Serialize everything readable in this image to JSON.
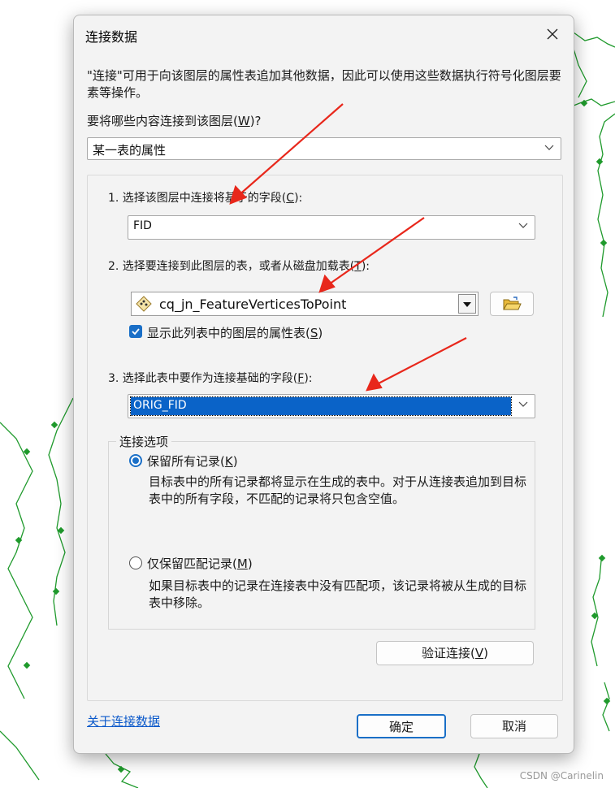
{
  "dialog": {
    "title": "连接数据",
    "description": "\"连接\"可用于向该图层的属性表追加其他数据，因此可以使用这些数据执行符号化图层要素等操作。",
    "question_prefix": "要将哪些内容连接到该图层(",
    "question_key": "W",
    "question_suffix": ")?",
    "join_type_value": "某一表的属性"
  },
  "step1": {
    "label_prefix": "1. 选择该图层中连接将基于的字段(",
    "key": "C",
    "label_suffix": "):",
    "value": "FID"
  },
  "step2": {
    "label_prefix": "2. 选择要连接到此图层的表，或者从磁盘加载表(",
    "key": "T",
    "label_suffix": "):",
    "value": "cq_jn_FeatureVerticesToPoint",
    "checkbox_prefix": "显示此列表中的图层的属性表(",
    "checkbox_key": "S",
    "checkbox_suffix": ")",
    "checkbox_checked": true
  },
  "step3": {
    "label_prefix": "3. 选择此表中要作为连接基础的字段(",
    "key": "F",
    "label_suffix": "):",
    "value": "ORIG_FID"
  },
  "options": {
    "legend": "连接选项",
    "keep_all_prefix": "保留所有记录(",
    "keep_all_key": "K",
    "keep_all_suffix": ")",
    "keep_all_desc": "目标表中的所有记录都将显示在生成的表中。对于从连接表追加到目标表中的所有字段，不匹配的记录将只包含空值。",
    "keep_match_prefix": "仅保留匹配记录(",
    "keep_match_key": "M",
    "keep_match_suffix": ")",
    "keep_match_desc": "如果目标表中的记录在连接表中没有匹配项，该记录将被从生成的目标表中移除。",
    "selected": "keep_all"
  },
  "buttons": {
    "validate_prefix": "验证连接(",
    "validate_key": "V",
    "validate_suffix": ")",
    "ok": "确定",
    "cancel": "取消"
  },
  "about_link": "关于连接数据",
  "watermark": "CSDN @Carinelin",
  "colors": {
    "accent": "#1a6fc7",
    "selection": "#0a63c8",
    "arrow": "#e8271b",
    "map_line": "#1f9a2c"
  }
}
